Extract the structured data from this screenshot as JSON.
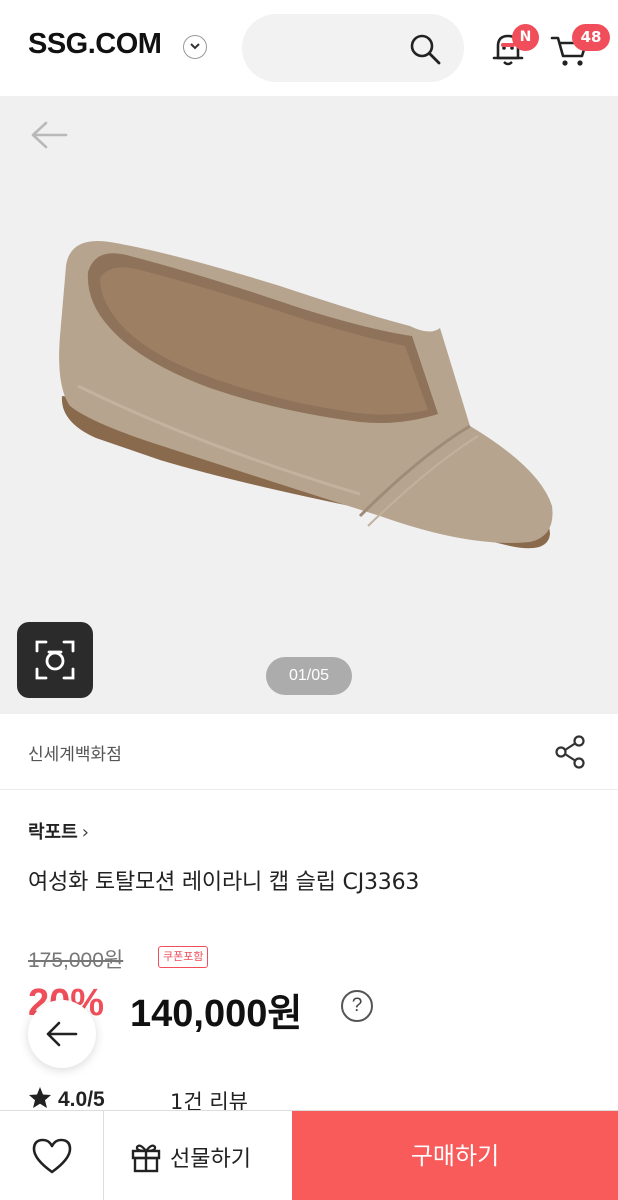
{
  "header": {
    "logo": "SSG.COM",
    "notification_badge": "N",
    "cart_count": "48"
  },
  "gallery": {
    "counter": "01/05"
  },
  "store": {
    "name": "신세계백화점"
  },
  "product": {
    "brand": "락포트",
    "brand_chevron": "›",
    "name": "여성화 토탈모션 레이라니 캡 슬립 CJ3363",
    "original_price": "175,000원",
    "coupon_badge": "쿠폰포함",
    "discount": "20%",
    "sale_price": "140,000원",
    "help": "?"
  },
  "rating": {
    "score": "4.0/5",
    "reviews": "1건 리뷰"
  },
  "bottom_bar": {
    "gift_label": "선물하기",
    "buy_label": "구매하기"
  },
  "colors": {
    "accent": "#f04e5a",
    "buy_button": "#f95a5a"
  },
  "icons": [
    "chevron-down-icon",
    "search-icon",
    "bell-icon",
    "cart-icon",
    "back-arrow-icon",
    "camera-lens-icon",
    "share-icon",
    "help-icon",
    "star-icon",
    "heart-icon",
    "gift-icon"
  ]
}
